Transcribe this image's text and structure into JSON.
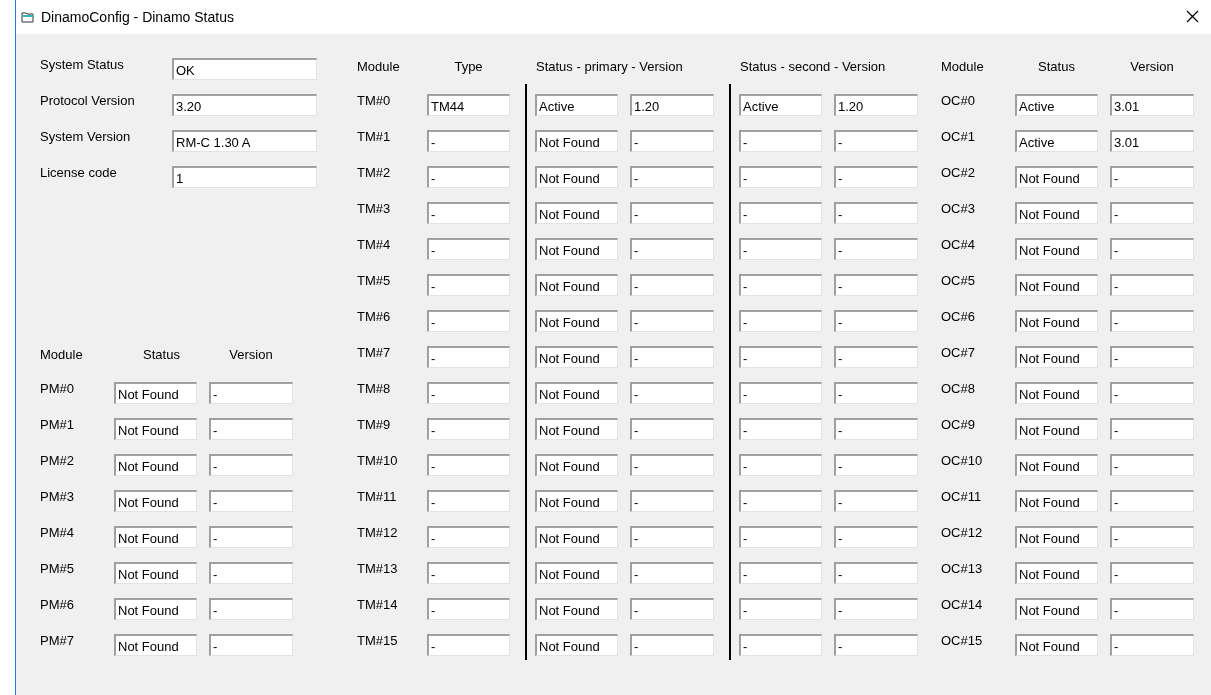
{
  "window": {
    "title": "DinamoConfig - Dinamo Status"
  },
  "system": [
    {
      "label": "System Status",
      "value": "OK"
    },
    {
      "label": "Protocol Version",
      "value": "3.20"
    },
    {
      "label": "System Version",
      "value": "RM-C 1.30 A"
    },
    {
      "label": "License code",
      "value": "1"
    }
  ],
  "pm": {
    "columns": [
      "Module",
      "Status",
      "Version"
    ],
    "rows": [
      {
        "module": "PM#0",
        "status": "Not Found",
        "version": "-"
      },
      {
        "module": "PM#1",
        "status": "Not Found",
        "version": "-"
      },
      {
        "module": "PM#2",
        "status": "Not Found",
        "version": "-"
      },
      {
        "module": "PM#3",
        "status": "Not Found",
        "version": "-"
      },
      {
        "module": "PM#4",
        "status": "Not Found",
        "version": "-"
      },
      {
        "module": "PM#5",
        "status": "Not Found",
        "version": "-"
      },
      {
        "module": "PM#6",
        "status": "Not Found",
        "version": "-"
      },
      {
        "module": "PM#7",
        "status": "Not Found",
        "version": "-"
      }
    ]
  },
  "tm": {
    "columns": [
      "Module",
      "Type",
      "Status - primary - Version",
      "Status - second - Version"
    ],
    "rows": [
      {
        "module": "TM#0",
        "type": "TM44",
        "primary_status": "Active",
        "primary_version": "1.20",
        "second_status": "Active",
        "second_version": "1.20"
      },
      {
        "module": "TM#1",
        "type": "-",
        "primary_status": "Not Found",
        "primary_version": "-",
        "second_status": "-",
        "second_version": "-"
      },
      {
        "module": "TM#2",
        "type": "-",
        "primary_status": "Not Found",
        "primary_version": "-",
        "second_status": "-",
        "second_version": "-"
      },
      {
        "module": "TM#3",
        "type": "-",
        "primary_status": "Not Found",
        "primary_version": "-",
        "second_status": "-",
        "second_version": "-"
      },
      {
        "module": "TM#4",
        "type": "-",
        "primary_status": "Not Found",
        "primary_version": "-",
        "second_status": "-",
        "second_version": "-"
      },
      {
        "module": "TM#5",
        "type": "-",
        "primary_status": "Not Found",
        "primary_version": "-",
        "second_status": "-",
        "second_version": "-"
      },
      {
        "module": "TM#6",
        "type": "-",
        "primary_status": "Not Found",
        "primary_version": "-",
        "second_status": "-",
        "second_version": "-"
      },
      {
        "module": "TM#7",
        "type": "-",
        "primary_status": "Not Found",
        "primary_version": "-",
        "second_status": "-",
        "second_version": "-"
      },
      {
        "module": "TM#8",
        "type": "-",
        "primary_status": "Not Found",
        "primary_version": "-",
        "second_status": "-",
        "second_version": "-"
      },
      {
        "module": "TM#9",
        "type": "-",
        "primary_status": "Not Found",
        "primary_version": "-",
        "second_status": "-",
        "second_version": "-"
      },
      {
        "module": "TM#10",
        "type": "-",
        "primary_status": "Not Found",
        "primary_version": "-",
        "second_status": "-",
        "second_version": "-"
      },
      {
        "module": "TM#11",
        "type": "-",
        "primary_status": "Not Found",
        "primary_version": "-",
        "second_status": "-",
        "second_version": "-"
      },
      {
        "module": "TM#12",
        "type": "-",
        "primary_status": "Not Found",
        "primary_version": "-",
        "second_status": "-",
        "second_version": "-"
      },
      {
        "module": "TM#13",
        "type": "-",
        "primary_status": "Not Found",
        "primary_version": "-",
        "second_status": "-",
        "second_version": "-"
      },
      {
        "module": "TM#14",
        "type": "-",
        "primary_status": "Not Found",
        "primary_version": "-",
        "second_status": "-",
        "second_version": "-"
      },
      {
        "module": "TM#15",
        "type": "-",
        "primary_status": "Not Found",
        "primary_version": "-",
        "second_status": "-",
        "second_version": "-"
      }
    ]
  },
  "oc": {
    "columns": [
      "Module",
      "Status",
      "Version"
    ],
    "rows": [
      {
        "module": "OC#0",
        "status": "Active",
        "version": "3.01"
      },
      {
        "module": "OC#1",
        "status": "Active",
        "version": "3.01"
      },
      {
        "module": "OC#2",
        "status": "Not Found",
        "version": "-"
      },
      {
        "module": "OC#3",
        "status": "Not Found",
        "version": "-"
      },
      {
        "module": "OC#4",
        "status": "Not Found",
        "version": "-"
      },
      {
        "module": "OC#5",
        "status": "Not Found",
        "version": "-"
      },
      {
        "module": "OC#6",
        "status": "Not Found",
        "version": "-"
      },
      {
        "module": "OC#7",
        "status": "Not Found",
        "version": "-"
      },
      {
        "module": "OC#8",
        "status": "Not Found",
        "version": "-"
      },
      {
        "module": "OC#9",
        "status": "Not Found",
        "version": "-"
      },
      {
        "module": "OC#10",
        "status": "Not Found",
        "version": "-"
      },
      {
        "module": "OC#11",
        "status": "Not Found",
        "version": "-"
      },
      {
        "module": "OC#12",
        "status": "Not Found",
        "version": "-"
      },
      {
        "module": "OC#13",
        "status": "Not Found",
        "version": "-"
      },
      {
        "module": "OC#14",
        "status": "Not Found",
        "version": "-"
      },
      {
        "module": "OC#15",
        "status": "Not Found",
        "version": "-"
      }
    ]
  }
}
